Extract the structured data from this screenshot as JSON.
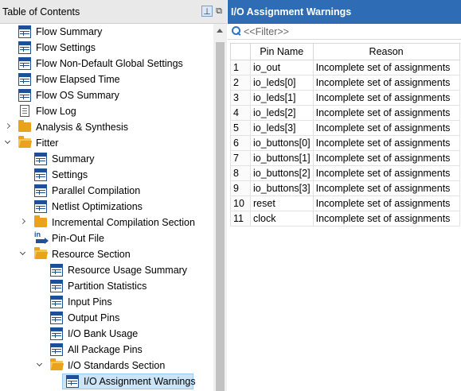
{
  "toc": {
    "title": "Table of Contents",
    "items": [
      {
        "label": "Flow Summary",
        "icon": "table-report-icon"
      },
      {
        "label": "Flow Settings",
        "icon": "table-report-icon"
      },
      {
        "label": "Flow Non-Default Global Settings",
        "icon": "table-report-icon"
      },
      {
        "label": "Flow Elapsed Time",
        "icon": "table-report-icon"
      },
      {
        "label": "Flow OS Summary",
        "icon": "table-report-icon"
      },
      {
        "label": "Flow Log",
        "icon": "log-file-icon"
      },
      {
        "label": "Analysis & Synthesis",
        "icon": "folder-icon"
      },
      {
        "label": "Fitter",
        "icon": "open-folder-icon"
      },
      {
        "label": "Summary",
        "icon": "table-report-icon"
      },
      {
        "label": "Settings",
        "icon": "table-report-icon"
      },
      {
        "label": "Parallel Compilation",
        "icon": "table-report-icon"
      },
      {
        "label": "Netlist Optimizations",
        "icon": "table-report-icon"
      },
      {
        "label": "Incremental Compilation Section",
        "icon": "folder-icon"
      },
      {
        "label": "Pin-Out File",
        "icon": "pin-out-file-icon"
      },
      {
        "label": "Resource Section",
        "icon": "open-folder-icon"
      },
      {
        "label": "Resource Usage Summary",
        "icon": "table-report-icon"
      },
      {
        "label": "Partition Statistics",
        "icon": "table-report-icon"
      },
      {
        "label": "Input Pins",
        "icon": "table-report-icon"
      },
      {
        "label": "Output Pins",
        "icon": "table-report-icon"
      },
      {
        "label": "I/O Bank Usage",
        "icon": "table-report-icon"
      },
      {
        "label": "All Package Pins",
        "icon": "table-report-icon"
      },
      {
        "label": "I/O Standards Section",
        "icon": "open-folder-icon"
      },
      {
        "label": "I/O Assignment Warnings",
        "icon": "table-report-icon"
      }
    ],
    "pin_glyph": "in"
  },
  "report": {
    "title": "I/O Assignment Warnings",
    "filter_placeholder": "<<Filter>>",
    "columns": [
      "",
      "Pin Name",
      "Reason"
    ],
    "rows": [
      {
        "idx": "1",
        "pin": "io_out",
        "reason": "Incomplete set of assignments"
      },
      {
        "idx": "2",
        "pin": "io_leds[0]",
        "reason": "Incomplete set of assignments"
      },
      {
        "idx": "3",
        "pin": "io_leds[1]",
        "reason": "Incomplete set of assignments"
      },
      {
        "idx": "4",
        "pin": "io_leds[2]",
        "reason": "Incomplete set of assignments"
      },
      {
        "idx": "5",
        "pin": "io_leds[3]",
        "reason": "Incomplete set of assignments"
      },
      {
        "idx": "6",
        "pin": "io_buttons[0]",
        "reason": "Incomplete set of assignments"
      },
      {
        "idx": "7",
        "pin": "io_buttons[1]",
        "reason": "Incomplete set of assignments"
      },
      {
        "idx": "8",
        "pin": "io_buttons[2]",
        "reason": "Incomplete set of assignments"
      },
      {
        "idx": "9",
        "pin": "io_buttons[3]",
        "reason": "Incomplete set of assignments"
      },
      {
        "idx": "10",
        "pin": "reset",
        "reason": "Incomplete set of assignments"
      },
      {
        "idx": "11",
        "pin": "clock",
        "reason": "Incomplete set of assignments"
      }
    ]
  },
  "colors": {
    "header_blue": "#2e6db6",
    "selection": "#cce4f7",
    "folder": "#e9a21a"
  }
}
